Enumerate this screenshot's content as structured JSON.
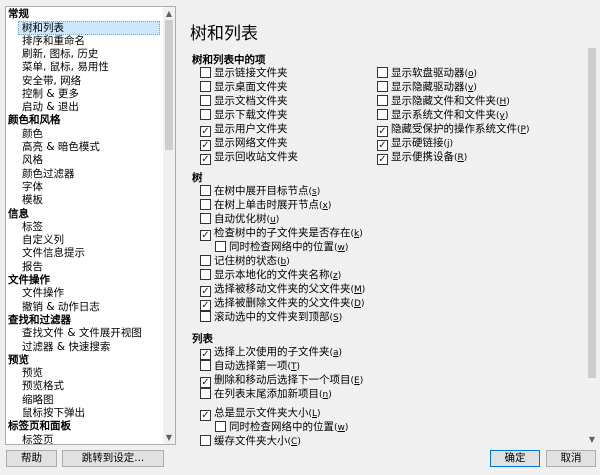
{
  "nav": {
    "items": [
      {
        "label": "常规",
        "type": "cat"
      },
      {
        "label": "树和列表",
        "type": "sub",
        "selected": true
      },
      {
        "label": "排序和重命名",
        "type": "sub"
      },
      {
        "label": "刷新, 图标, 历史",
        "type": "sub"
      },
      {
        "label": "菜单, 鼠标, 易用性",
        "type": "sub"
      },
      {
        "label": "安全带, 网络",
        "type": "sub"
      },
      {
        "label": "控制 & 更多",
        "type": "sub"
      },
      {
        "label": "启动 & 退出",
        "type": "sub"
      },
      {
        "label": "颜色和风格",
        "type": "cat"
      },
      {
        "label": "颜色",
        "type": "sub"
      },
      {
        "label": "高亮 & 暗色模式",
        "type": "sub"
      },
      {
        "label": "风格",
        "type": "sub"
      },
      {
        "label": "颜色过滤器",
        "type": "sub"
      },
      {
        "label": "字体",
        "type": "sub"
      },
      {
        "label": "模板",
        "type": "sub"
      },
      {
        "label": "信息",
        "type": "cat"
      },
      {
        "label": "标签",
        "type": "sub"
      },
      {
        "label": "自定义列",
        "type": "sub"
      },
      {
        "label": "文件信息提示",
        "type": "sub"
      },
      {
        "label": "报告",
        "type": "sub"
      },
      {
        "label": "文件操作",
        "type": "cat"
      },
      {
        "label": "文件操作",
        "type": "sub"
      },
      {
        "label": "撤销 & 动作日志",
        "type": "sub"
      },
      {
        "label": "查找和过滤器",
        "type": "cat"
      },
      {
        "label": "查找文件 & 文件展开视图",
        "type": "sub"
      },
      {
        "label": "过滤器 & 快速搜索",
        "type": "sub"
      },
      {
        "label": "预览",
        "type": "cat"
      },
      {
        "label": "预览",
        "type": "sub"
      },
      {
        "label": "预览格式",
        "type": "sub"
      },
      {
        "label": "缩略图",
        "type": "sub"
      },
      {
        "label": "鼠标按下弹出",
        "type": "sub"
      },
      {
        "label": "标签页和面板",
        "type": "cat"
      },
      {
        "label": "标签页",
        "type": "sub"
      }
    ]
  },
  "page_title": "树和列表",
  "sections": [
    {
      "title": "树和列表中的项",
      "rows": [
        {
          "label": "显示链接文件夹",
          "checked": false,
          "col": 0
        },
        {
          "label": "显示桌面文件夹",
          "checked": false,
          "col": 0
        },
        {
          "label": "显示文档文件夹",
          "checked": false,
          "col": 0
        },
        {
          "label": "显示下载文件夹",
          "checked": false,
          "col": 0
        },
        {
          "label": "显示用户文件夹",
          "checked": true,
          "col": 0
        },
        {
          "label": "显示网络文件夹",
          "checked": true,
          "col": 0
        },
        {
          "label": "显示回收站文件夹",
          "checked": true,
          "col": 0
        },
        {
          "label": "显示软盘驱动器",
          "key": "o",
          "checked": false,
          "col": 1
        },
        {
          "label": "显示隐藏驱动器",
          "key": "v",
          "checked": false,
          "col": 1
        },
        {
          "label": "显示隐藏文件和文件夹",
          "key": "H",
          "checked": false,
          "col": 1
        },
        {
          "label": "显示系统文件和文件夹",
          "key": "y",
          "checked": false,
          "col": 1
        },
        {
          "label": "隐藏受保护的操作系统文件",
          "key": "P",
          "checked": true,
          "col": 1
        },
        {
          "label": "显示硬链接",
          "key": "j",
          "checked": true,
          "col": 1
        },
        {
          "label": "显示便携设备",
          "key": "R",
          "checked": true,
          "col": 1
        }
      ]
    },
    {
      "title": "树",
      "rows": [
        {
          "label": "在树中展开目标节点",
          "key": "s",
          "checked": false
        },
        {
          "label": "在树上单击时展开节点",
          "key": "x",
          "checked": false
        },
        {
          "label": "自动优化树",
          "key": "u",
          "checked": false
        },
        {
          "label": "检查树中的子文件夹是否存在",
          "key": "k",
          "checked": true
        },
        {
          "label": "同时检查网络中的位置",
          "key": "w",
          "checked": false,
          "indent": true
        },
        {
          "label": "记住树的状态",
          "key": "b",
          "checked": false
        },
        {
          "label": "显示本地化的文件夹名称",
          "key": "z",
          "checked": false
        },
        {
          "label": "选择被移动文件夹的父文件夹",
          "key": "M",
          "checked": true
        },
        {
          "label": "选择被删除文件夹的父文件夹",
          "key": "D",
          "checked": true
        },
        {
          "label": "滚动选中的文件夹到顶部",
          "key": "S",
          "checked": false
        }
      ]
    },
    {
      "title": "列表",
      "rows": [
        {
          "label": "选择上次使用的子文件夹",
          "key": "a",
          "checked": true
        },
        {
          "label": "自动选择第一项",
          "key": "T",
          "checked": false
        },
        {
          "label": "删除和移动后选择下一个项目",
          "key": "E",
          "checked": true
        },
        {
          "label": "在列表末尾添加新项目",
          "key": "n",
          "checked": false
        },
        {
          "label": "总是显示文件夹大小",
          "key": "L",
          "checked": true,
          "gap": true
        },
        {
          "label": "同时检查网络中的位置",
          "key": "w",
          "checked": false,
          "indent": true
        },
        {
          "label": "缓存文件夹大小",
          "key": "C",
          "checked": false
        }
      ]
    }
  ],
  "buttons": {
    "help": "帮助",
    "goto": "跳转到设定...",
    "ok": "确定",
    "cancel": "取消"
  }
}
